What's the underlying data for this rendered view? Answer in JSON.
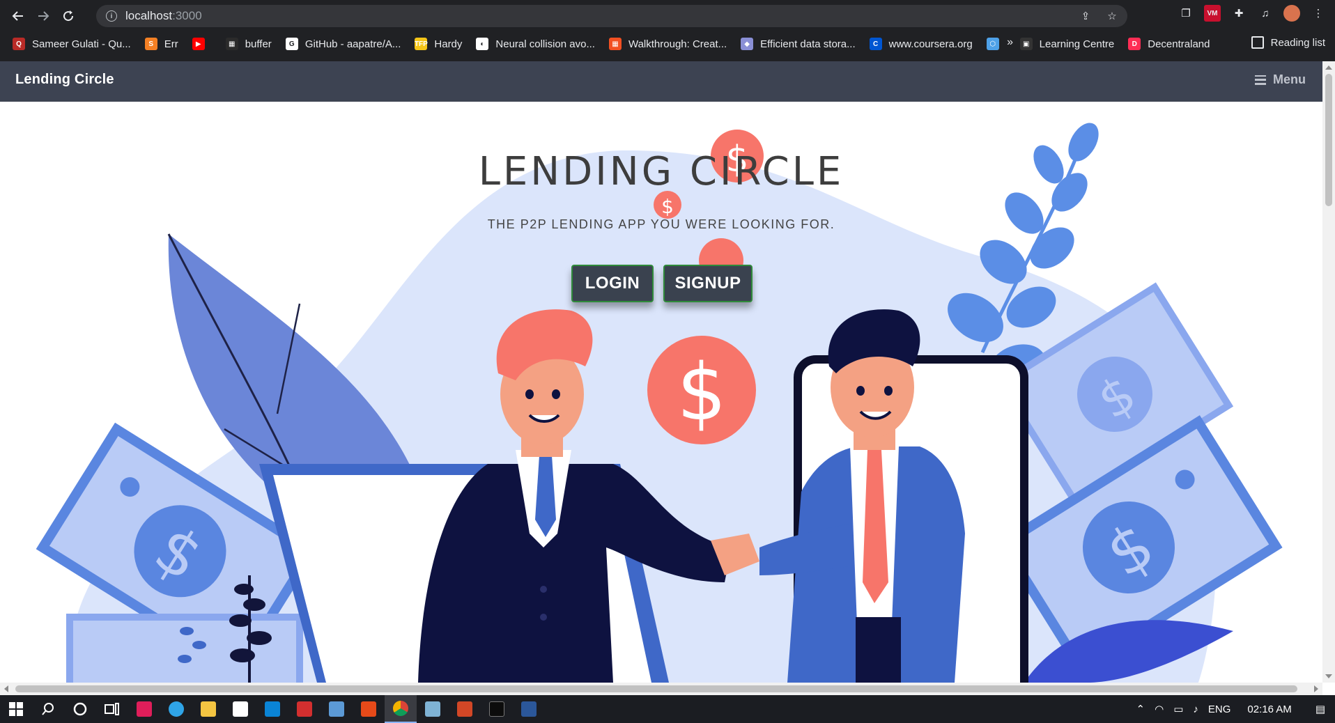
{
  "browser": {
    "url_host": "localhost",
    "url_port": ":3000",
    "bookmarks": [
      {
        "label": "Sameer Gulati - Qu...",
        "color": "#b92b27",
        "glyph": "Q"
      },
      {
        "label": "Err",
        "color": "#f48024",
        "glyph": "S"
      },
      {
        "label": "",
        "color": "#ff0000",
        "glyph": "▶"
      },
      {
        "label": "buffer",
        "color": "#2b2b2b",
        "glyph": "▦"
      },
      {
        "label": "GitHub - aapatre/A...",
        "color": "#ffffff",
        "glyph": "G"
      },
      {
        "label": "Hardy",
        "color": "#f5c518",
        "glyph": "TFP"
      },
      {
        "label": "Neural collision avo...",
        "color": "#ffffff",
        "glyph": "◐"
      },
      {
        "label": "Walkthrough: Creat...",
        "color": "#f25022",
        "glyph": "▦"
      },
      {
        "label": "Efficient data stora...",
        "color": "#8a8fd6",
        "glyph": "◆"
      },
      {
        "label": "www.coursera.org",
        "color": "#0056d2",
        "glyph": "C"
      },
      {
        "label": "",
        "color": "#4ea1e8",
        "glyph": "⬡"
      },
      {
        "label": "Learning Centre",
        "color": "#333333",
        "glyph": "▣"
      },
      {
        "label": "Decentraland",
        "color": "#ff2d55",
        "glyph": "D"
      }
    ],
    "bookmarks_more": "»",
    "reading_list": "Reading list"
  },
  "app": {
    "brand": "Lending Circle",
    "menu_label": "Menu"
  },
  "hero": {
    "title": "LENDING CIRCLE",
    "subtitle": "THE P2P LENDING APP YOU WERE LOOKING FOR.",
    "login_label": "LOGIN",
    "signup_label": "SIGNUP"
  },
  "colors": {
    "navbar": "#3d4352",
    "blob": "#d9e4fb",
    "accent_coin": "#f7756a",
    "blue_primary": "#3f68c8"
  },
  "taskbar": {
    "language": "ENG",
    "time": "02:16 AM"
  }
}
